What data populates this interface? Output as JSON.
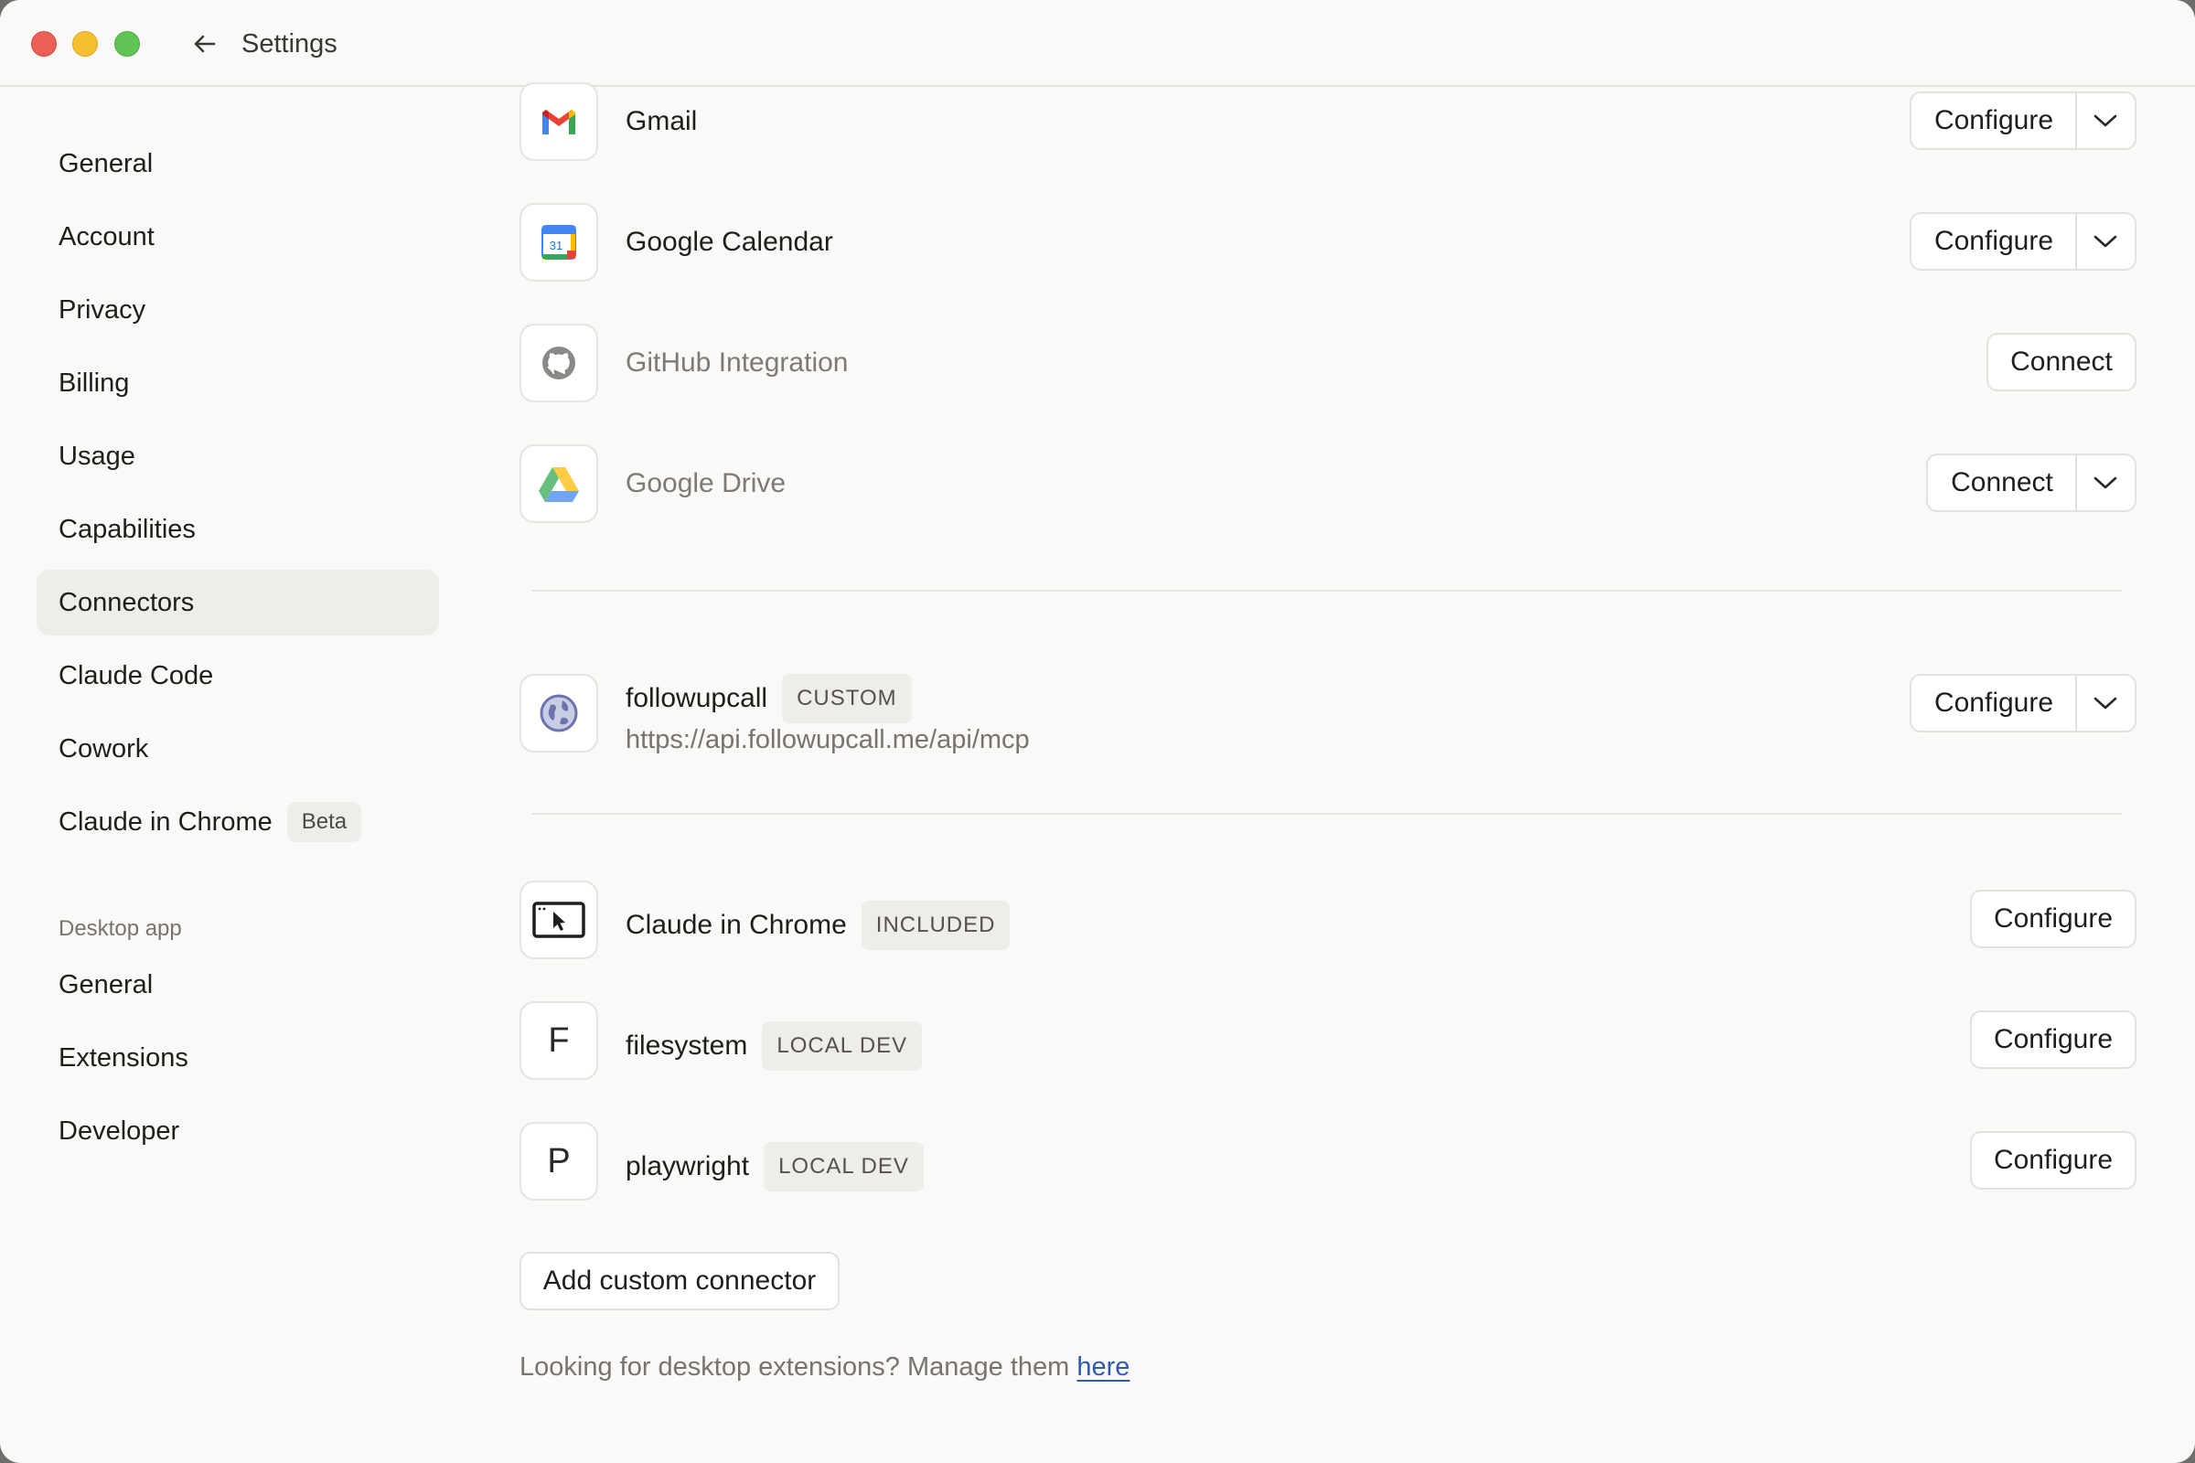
{
  "window": {
    "title": "Settings"
  },
  "sidebar": {
    "items": [
      {
        "label": "General"
      },
      {
        "label": "Account"
      },
      {
        "label": "Privacy"
      },
      {
        "label": "Billing"
      },
      {
        "label": "Usage"
      },
      {
        "label": "Capabilities"
      },
      {
        "label": "Connectors",
        "active": true
      },
      {
        "label": "Claude Code"
      },
      {
        "label": "Cowork"
      },
      {
        "label": "Claude in Chrome",
        "badge": "Beta"
      }
    ],
    "desktop_section_label": "Desktop app",
    "desktop_items": [
      {
        "label": "General"
      },
      {
        "label": "Extensions"
      },
      {
        "label": "Developer"
      }
    ]
  },
  "connectors": [
    {
      "name": "Gmail",
      "icon": "gmail-icon",
      "button": "Configure",
      "dropdown": true
    },
    {
      "name": "Google Calendar",
      "icon": "google-calendar-icon",
      "icon_text": "31",
      "button": "Configure",
      "dropdown": true
    },
    {
      "name": "GitHub Integration",
      "icon": "github-icon",
      "button": "Connect",
      "dropdown": false,
      "muted": true
    },
    {
      "name": "Google Drive",
      "icon": "google-drive-icon",
      "button": "Connect",
      "dropdown": true,
      "muted": true
    }
  ],
  "custom_connectors": [
    {
      "name": "followupcall",
      "tag": "CUSTOM",
      "url": "https://api.followupcall.me/api/mcp",
      "icon": "globe-icon",
      "button": "Configure",
      "dropdown": true
    }
  ],
  "local_connectors": [
    {
      "name": "Claude in Chrome",
      "tag": "INCLUDED",
      "icon": "browser-cursor-icon",
      "button": "Configure"
    },
    {
      "name": "filesystem",
      "tag": "LOCAL DEV",
      "icon_letter": "F",
      "button": "Configure"
    },
    {
      "name": "playwright",
      "tag": "LOCAL DEV",
      "icon_letter": "P",
      "button": "Configure"
    }
  ],
  "add_button": "Add custom connector",
  "footer": {
    "text": "Looking for desktop extensions? Manage them",
    "link": "here"
  },
  "colors": {
    "background": "#faf9f7",
    "active_nav": "#efedea",
    "link": "#2d5bb0"
  }
}
